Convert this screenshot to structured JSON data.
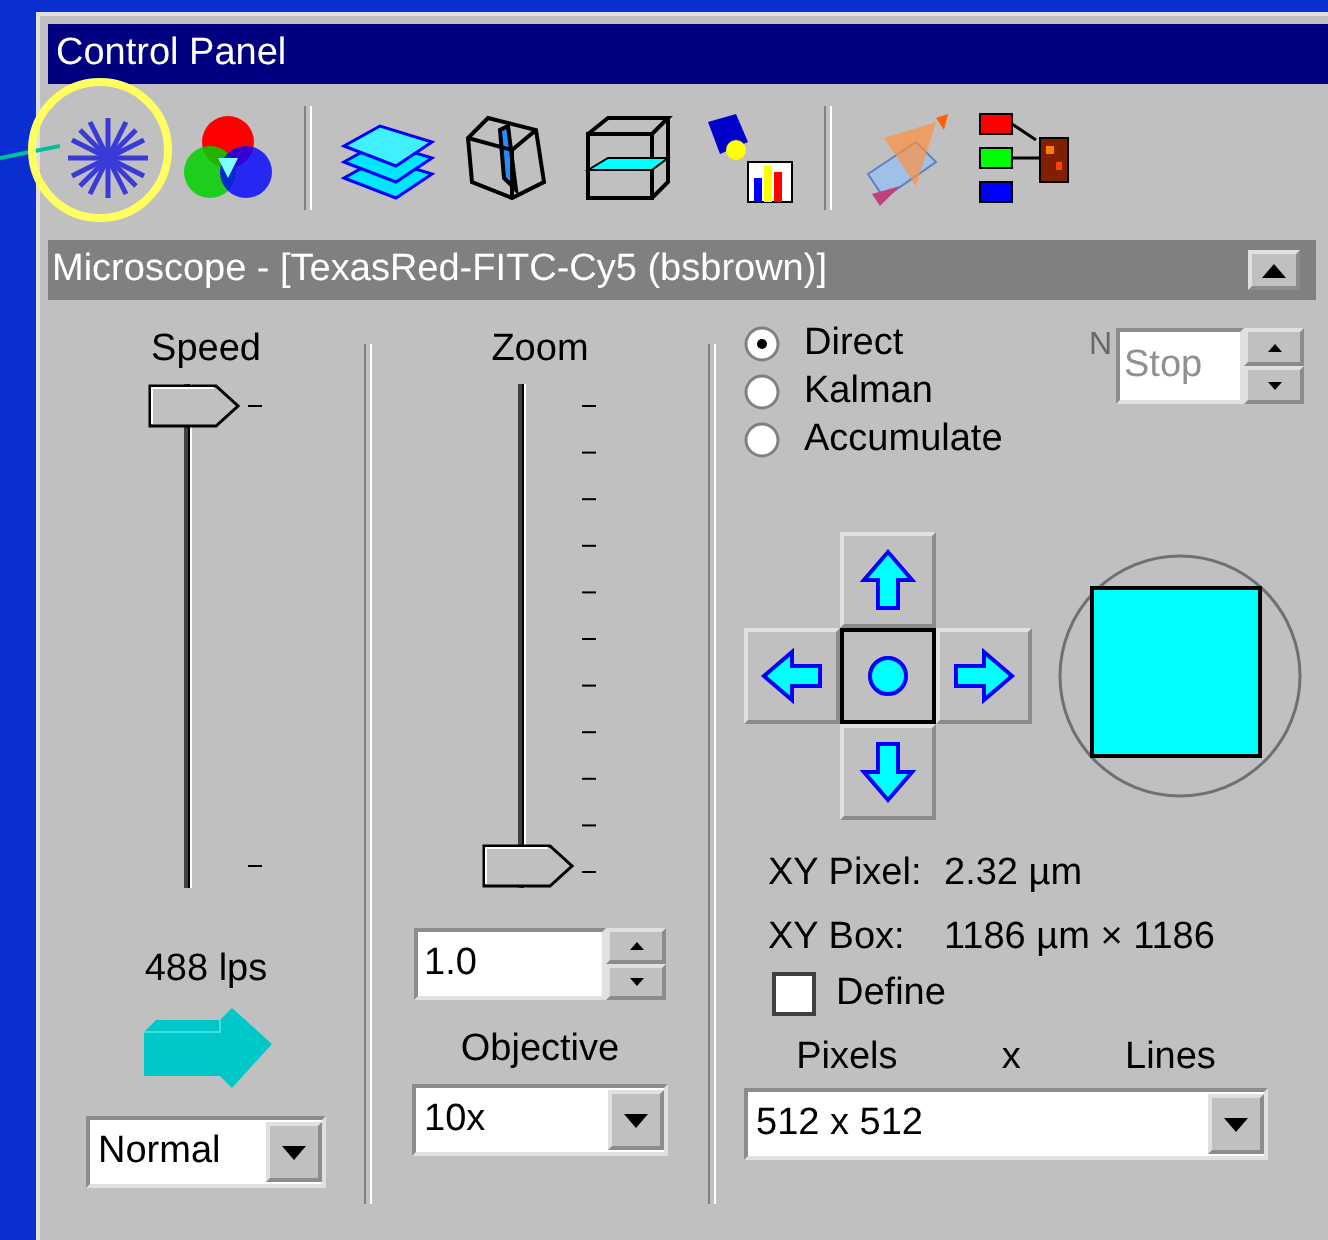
{
  "window": {
    "title": "Control Panel"
  },
  "toolbar": [
    {
      "kind": "star",
      "highlighted": true
    },
    {
      "kind": "color",
      "highlighted": false
    },
    {
      "kind": "separator"
    },
    {
      "kind": "layers",
      "highlighted": false
    },
    {
      "kind": "slice",
      "highlighted": false
    },
    {
      "kind": "plane",
      "highlighted": false
    },
    {
      "kind": "lamp",
      "highlighted": false
    },
    {
      "kind": "separator"
    },
    {
      "kind": "prism",
      "highlighted": false
    },
    {
      "kind": "channels",
      "highlighted": false
    }
  ],
  "subtitle": "Microscope - [TexasRed-FITC-Cy5 (bsbrown)]",
  "speed": {
    "label": "Speed",
    "level": 1,
    "reading": "488 lps",
    "mode": "Normal"
  },
  "zoom": {
    "label": "Zoom",
    "level": 0,
    "value": "1.0",
    "objective_label": "Objective",
    "objective": "10x"
  },
  "averaging": {
    "options": [
      {
        "label": "Direct",
        "selected": true
      },
      {
        "label": "Kalman",
        "selected": false
      },
      {
        "label": "Accumulate",
        "selected": false
      }
    ],
    "n_label": "N",
    "n_value": "Stop",
    "n_disabled": true
  },
  "xy_pixel": {
    "label": "XY Pixel:",
    "value": "2.32 µm"
  },
  "xy_box": {
    "label": "XY Box:",
    "value": "1186 µm × 1186"
  },
  "define": {
    "label": "Define",
    "checked": false
  },
  "resolution": {
    "labels": [
      "Pixels",
      "x",
      "Lines"
    ],
    "value": "512 x 512"
  }
}
